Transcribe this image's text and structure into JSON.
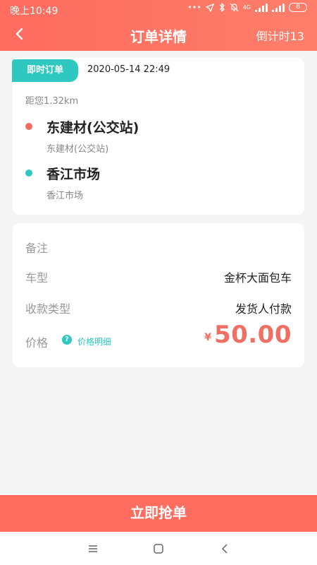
{
  "status_bar": {
    "time": "晚上10:49",
    "network_label": "4G",
    "battery": "8"
  },
  "nav": {
    "title": "订单详情",
    "countdown": "倒计时13"
  },
  "order": {
    "tag": "即时订单",
    "time": "2020-05-14 22:49",
    "distance": "距您1.32km",
    "from": {
      "name": "东建材(公交站)",
      "detail": "东建材(公交站)"
    },
    "to": {
      "name": "香江市场",
      "detail": "香江市场"
    }
  },
  "details": {
    "remark_label": "备注",
    "vehicle_label": "车型",
    "vehicle_value": "金杯大面包车",
    "payment_label": "收款类型",
    "payment_value": "发货人付款",
    "price_label": "价格",
    "price_detail_link": "价格明细",
    "currency": "¥",
    "price": "50.00"
  },
  "actions": {
    "grab_button": "立即抢单"
  },
  "colors": {
    "primary": "#fe6c5f",
    "accent": "#2ec8c0",
    "price": "#f16f62"
  }
}
